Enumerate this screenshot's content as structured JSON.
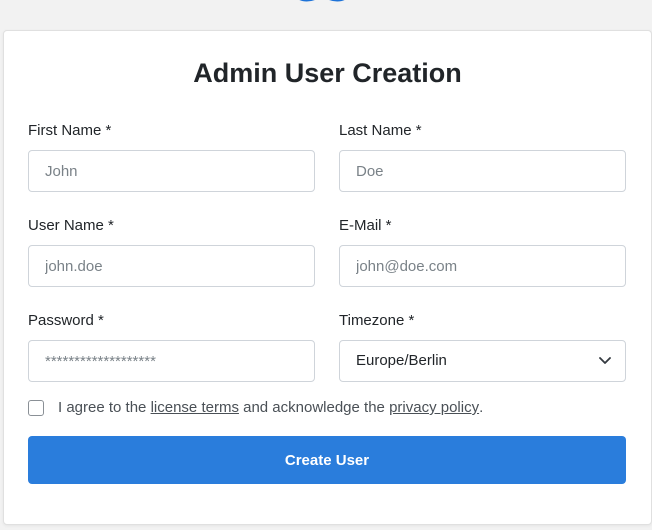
{
  "form": {
    "title": "Admin User Creation",
    "first_name": {
      "label": "First Name *",
      "placeholder": "John"
    },
    "last_name": {
      "label": "Last Name *",
      "placeholder": "Doe"
    },
    "user_name": {
      "label": "User Name *",
      "placeholder": "john.doe"
    },
    "email": {
      "label": "E-Mail *",
      "placeholder": "john@doe.com"
    },
    "password": {
      "label": "Password *",
      "placeholder": "*******************"
    },
    "timezone": {
      "label": "Timezone *",
      "value": "Europe/Berlin"
    },
    "agree": {
      "prefix": "I agree to the",
      "license_link": "license terms",
      "middle": "and acknowledge the",
      "privacy_link": "privacy policy",
      "suffix": "."
    },
    "submit_label": "Create User"
  },
  "colors": {
    "accent": "#2a7ddc",
    "logo": "#1e73d8"
  }
}
